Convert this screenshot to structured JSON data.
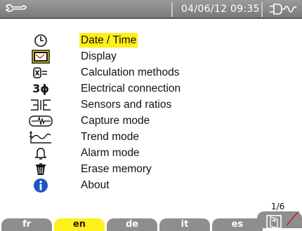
{
  "status_bar": {
    "datetime": "04/06/12  09:35",
    "left_icon": "wrench-icon",
    "right_icon": "power-plug-wave-icon"
  },
  "menu": {
    "items": [
      {
        "label": "Date / Time",
        "icon": "clock-icon",
        "selected": true
      },
      {
        "label": "Display",
        "icon": "display-icon",
        "selected": false
      },
      {
        "label": "Calculation methods",
        "icon": "calculation-icon",
        "selected": false
      },
      {
        "label": "Electrical connection",
        "icon": "three-phase-icon",
        "icon_text": "3ϕ",
        "selected": false
      },
      {
        "label": "Sensors and ratios",
        "icon": "sensors-icon",
        "selected": false
      },
      {
        "label": "Capture mode",
        "icon": "capture-icon",
        "selected": false
      },
      {
        "label": "Trend mode",
        "icon": "trend-icon",
        "selected": false
      },
      {
        "label": "Alarm mode",
        "icon": "bell-icon",
        "selected": false
      },
      {
        "label": "Erase memory",
        "icon": "trash-icon",
        "selected": false
      },
      {
        "label": "About",
        "icon": "info-icon",
        "selected": false
      }
    ]
  },
  "tabs": [
    {
      "label": "fr",
      "active": false
    },
    {
      "label": "en",
      "active": true
    },
    {
      "label": "de",
      "active": false
    },
    {
      "label": "it",
      "active": false
    },
    {
      "label": "es",
      "active": false
    }
  ],
  "page_indicator": "1/6",
  "colors": {
    "highlight": "#ffef1a",
    "bar_gray": "#8e8e8e",
    "info_blue": "#1a56c4",
    "cursor_red": "#d02020"
  }
}
